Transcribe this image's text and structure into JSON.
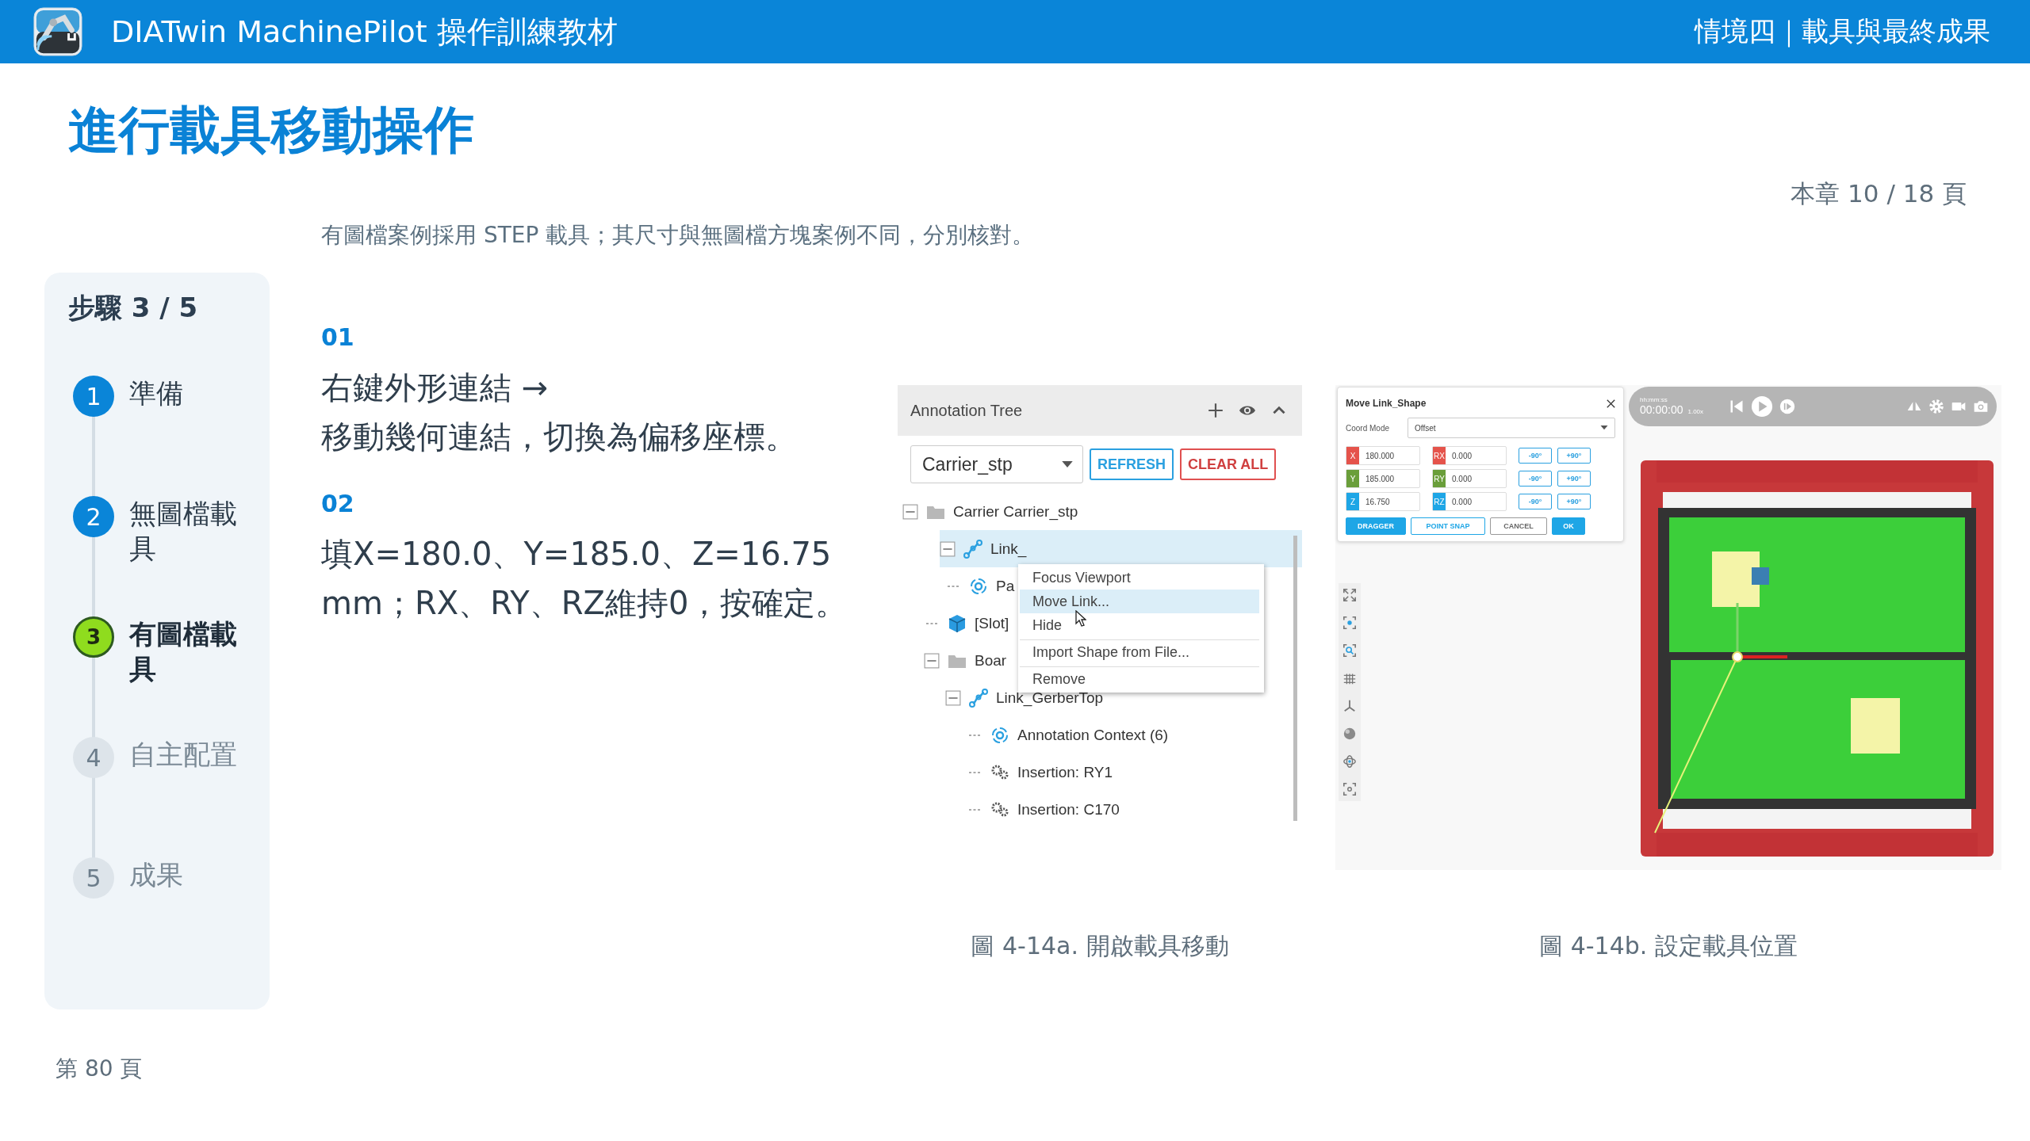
{
  "header": {
    "app_title": "DIATwin MachinePilot 操作訓練教材",
    "section": "情境四｜載具與最終成果"
  },
  "page_title": "進行載具移動操作",
  "chapter_progress": "本章 10 / 18 頁",
  "subtitle": "有圖檔案例採用 STEP 載具；其尺寸與無圖檔方塊案例不同，分別核對。",
  "stepper": {
    "heading": "步驟 3 / 5",
    "steps": [
      {
        "number": "1",
        "label": "準備",
        "kind": "done"
      },
      {
        "number": "2",
        "label": "無圖檔載具",
        "kind": "done"
      },
      {
        "number": "3",
        "label": "有圖檔載具",
        "kind": "current"
      },
      {
        "number": "4",
        "label": "自主配置",
        "kind": "todo"
      },
      {
        "number": "5",
        "label": "成果",
        "kind": "todo"
      }
    ]
  },
  "page_number": "第 80 頁",
  "instructions": [
    {
      "number": "01",
      "lines": [
        "右鍵外形連結 →",
        "移動幾何連結，切換為偏移座標。"
      ]
    },
    {
      "number": "02",
      "lines": [
        "填X=180.0、Y=185.0、Z=16.75 mm；RX、RY、RZ維持0，按確定。"
      ]
    }
  ],
  "figures": [
    {
      "caption": "圖 4-14a. 開啟載具移動",
      "annotation_tree": {
        "title": "Annotation Tree",
        "dropdown": {
          "value": "Carrier_stp"
        },
        "buttons": [
          {
            "label": "REFRESH",
            "kind": "primary"
          },
          {
            "label": "CLEAR ALL",
            "kind": "danger"
          }
        ],
        "nodes": [
          {
            "label": "Carrier  Carrier_stp",
            "kind": "folder",
            "selected": false,
            "expanded": true,
            "children": [
              {
                "label": "Link_",
                "kind": "link",
                "selected": true,
                "expanded": true,
                "children": [
                  {
                    "label": "Pa",
                    "kind": "context",
                    "selected": false
                  }
                ]
              },
              {
                "label": "[Slot]",
                "kind": "cube",
                "selected": false
              },
              {
                "label": "Boar",
                "kind": "folder",
                "selected": false,
                "expanded": true,
                "children": [
                  {
                    "label": "Link_GerberTop",
                    "kind": "link",
                    "selected": false,
                    "expanded": true,
                    "children": [
                      {
                        "label": "Annotation Context (6)",
                        "kind": "context",
                        "selected": false
                      },
                      {
                        "label": "Insertion: RY1",
                        "kind": "insertion",
                        "selected": false
                      },
                      {
                        "label": "Insertion: C170",
                        "kind": "insertion",
                        "selected": false
                      }
                    ]
                  }
                ]
              }
            ]
          }
        ],
        "context_menu": [
          {
            "label": "Focus Viewport",
            "selected": false,
            "divider_above": false
          },
          {
            "label": "Move Link...",
            "selected": true,
            "divider_above": false
          },
          {
            "label": "Hide",
            "selected": false,
            "divider_above": false
          },
          {
            "label": "Import Shape from File...",
            "selected": false,
            "divider_above": true
          },
          {
            "label": "Remove",
            "selected": false,
            "divider_above": true
          }
        ]
      }
    },
    {
      "caption": "圖 4-14b. 設定載具位置",
      "move_dialog": {
        "title": "Move Link_Shape",
        "coord_mode": {
          "label": "Coord Mode",
          "value": "Offset"
        },
        "rows": [
          {
            "axis": "X",
            "value": "180.000",
            "rot_axis": "RX",
            "rot_value": "0.000",
            "color": "#e5534b",
            "minus": "-90°",
            "plus": "+90°"
          },
          {
            "axis": "Y",
            "value": "185.000",
            "rot_axis": "RY",
            "rot_value": "0.000",
            "color": "#6a9e3a",
            "minus": "-90°",
            "plus": "+90°"
          },
          {
            "axis": "Z",
            "value": "16.750",
            "rot_axis": "RZ",
            "rot_value": "0.000",
            "color": "#1ea6e6",
            "minus": "-90°",
            "plus": "+90°"
          }
        ],
        "buttons": [
          {
            "label": "DRAGGER",
            "kind": "filled"
          },
          {
            "label": "POINT SNAP",
            "kind": "outline"
          },
          {
            "label": "CANCEL",
            "kind": "neutral"
          },
          {
            "label": "OK",
            "kind": "filled"
          }
        ]
      },
      "player": {
        "time_label": "hh:mm:ss",
        "time": "00:00:00",
        "speed": "1.00x"
      }
    }
  ]
}
